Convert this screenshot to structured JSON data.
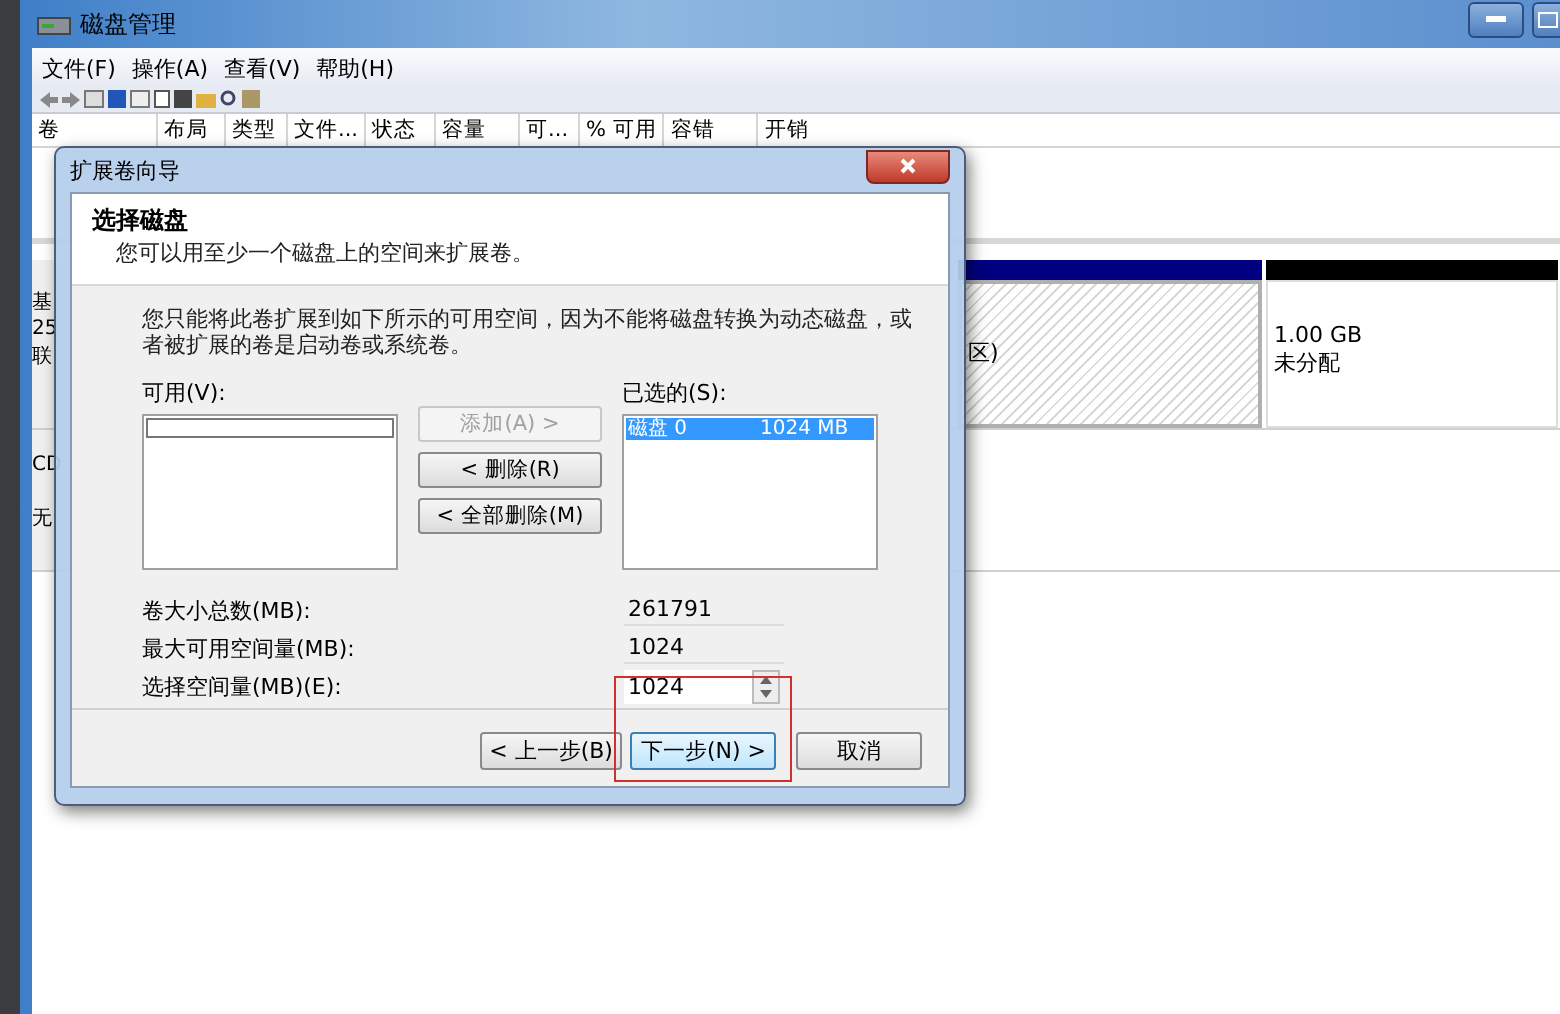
{
  "window": {
    "title": "磁盘管理"
  },
  "menu": [
    "文件(F)",
    "操作(A)",
    "查看(V)",
    "帮助(H)"
  ],
  "volume_table": {
    "columns": [
      "卷",
      "布局",
      "类型",
      "文件...",
      "状态",
      "容量",
      "可...",
      "% 可用",
      "容错",
      "开销"
    ]
  },
  "disks": [
    {
      "labels": [
        "基",
        "25",
        "联"
      ],
      "partitions": [
        {
          "kind": "primary",
          "lines": [
            "区)"
          ]
        },
        {
          "kind": "unallocated",
          "lines": [
            "1.00 GB",
            "未分配"
          ]
        }
      ]
    },
    {
      "labels": [
        "CD",
        "无"
      ]
    }
  ],
  "dialog": {
    "title": "扩展卷向导",
    "heading": "选择磁盘",
    "subheading": "您可以用至少一个磁盘上的空间来扩展卷。",
    "description": "您只能将此卷扩展到如下所示的可用空间，因为不能将磁盘转换为动态磁盘，或者被扩展的卷是启动卷或系统卷。",
    "available": {
      "label": "可用(V):"
    },
    "chosen": {
      "label": "已选的(S):",
      "items": [
        {
          "disk": "磁盘 0",
          "size": "1024 MB",
          "selected": true
        }
      ]
    },
    "list_buttons": [
      {
        "label": "添加(A) >",
        "disabled": true
      },
      {
        "label": "< 删除(R)",
        "disabled": false
      },
      {
        "label": "< 全部删除(M)",
        "disabled": false
      }
    ],
    "fields": [
      {
        "kind": "readonly",
        "label": "卷大小总数(MB):",
        "value": "261791"
      },
      {
        "kind": "readonly",
        "label": "最大可用空间量(MB):",
        "value": "1024"
      },
      {
        "kind": "spinner",
        "label": "选择空间量(MB)(E):",
        "value": "1024"
      }
    ],
    "nav_buttons": [
      {
        "label": "< 上一步(B)",
        "focused": false,
        "highlighted": false
      },
      {
        "label": "下一步(N) >",
        "focused": true,
        "highlighted": true
      },
      {
        "label": "取消",
        "focused": false,
        "highlighted": false
      }
    ]
  }
}
